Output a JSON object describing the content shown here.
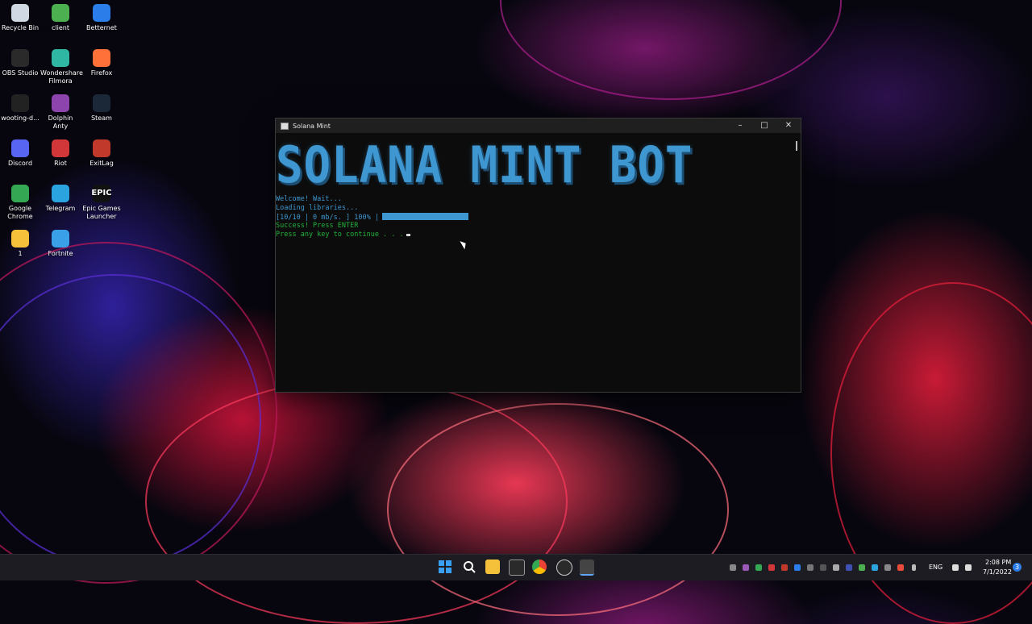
{
  "desktop": {
    "icons": [
      {
        "label": "Recycle Bin",
        "icon": "recycle-bin-icon",
        "color": "#cfd8e3"
      },
      {
        "label": "client",
        "icon": "client-icon",
        "color": "#4caf50"
      },
      {
        "label": "Betternet",
        "icon": "betternet-icon",
        "color": "#2b7de9"
      },
      {
        "label": "OBS Studio",
        "icon": "obs-icon",
        "color": "#2a2a2a"
      },
      {
        "label": "Wondershare Filmora",
        "icon": "filmora-icon",
        "color": "#2fb7a3"
      },
      {
        "label": "Firefox",
        "icon": "firefox-icon",
        "color": "#ff7139"
      },
      {
        "label": "wooting-d...",
        "icon": "wooting-icon",
        "color": "#222222"
      },
      {
        "label": "Dolphin Anty",
        "icon": "dolphin-anty-icon",
        "color": "#8e44ad"
      },
      {
        "label": "Steam",
        "icon": "steam-icon",
        "color": "#1b2838"
      },
      {
        "label": "Discord",
        "icon": "discord-icon",
        "color": "#5865f2"
      },
      {
        "label": "Riot",
        "icon": "riot-icon",
        "color": "#d13639"
      },
      {
        "label": "ExitLag",
        "icon": "exitlag-icon",
        "color": "#c0392b"
      },
      {
        "label": "Google Chrome",
        "icon": "chrome-icon",
        "color": "#34a853"
      },
      {
        "label": "Telegram",
        "icon": "telegram-icon",
        "color": "#2aa3df"
      },
      {
        "label": "Epic Games Launcher",
        "icon": "epic-games-icon",
        "color": "#111111",
        "badge": "EPIC"
      },
      {
        "label": "1",
        "icon": "folder-icon",
        "color": "#f5c03a"
      },
      {
        "label": "Fortnite",
        "icon": "fortnite-icon",
        "color": "#3aa0e8"
      }
    ]
  },
  "window": {
    "title": "Solana Mint",
    "minimize": "–",
    "maximize": "□",
    "close": "✕",
    "banner": "SOLANA MINT BOT",
    "lines": {
      "welcome": "Welcome! Wait...",
      "loading": "Loading libraries...",
      "progress_text": "[10/10 | 0 mb/s. ] 100% |",
      "progress_value": 1.0,
      "success": "Success! Press ENTER",
      "continue": "Press any key to continue . . ."
    },
    "colors": {
      "accent": "#3e97d1",
      "success": "#23b23b"
    }
  },
  "taskbar": {
    "apps": [
      "start-icon",
      "search-icon",
      "file-explorer-icon",
      "store-icon",
      "chrome-icon",
      "obs-icon",
      "terminal-icon"
    ],
    "tray": {
      "language": "ENG",
      "time": "2:08 PM",
      "date": "7/1/2022",
      "notification_count": "3"
    }
  }
}
